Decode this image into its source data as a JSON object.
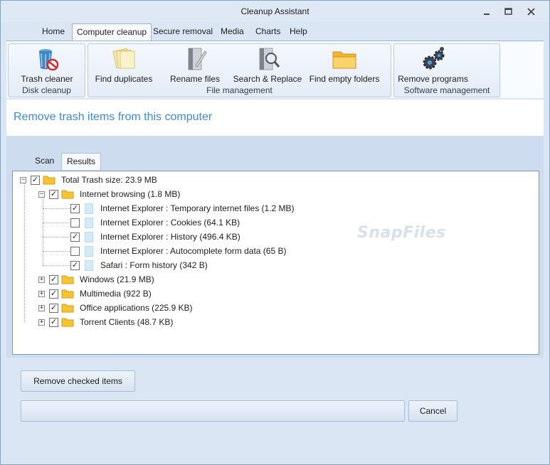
{
  "window": {
    "title": "Cleanup Assistant"
  },
  "menu": [
    {
      "label": "Home"
    },
    {
      "label": "Computer cleanup"
    },
    {
      "label": "Secure removal"
    },
    {
      "label": "Media"
    },
    {
      "label": "Charts"
    },
    {
      "label": "Help"
    }
  ],
  "ribbon": {
    "disk_cleanup": {
      "label": "Disk cleanup",
      "trash_cleaner": "Trash cleaner"
    },
    "file_management": {
      "label": "File management",
      "find_duplicates": "Find duplicates",
      "rename_files": "Rename files",
      "search_replace": "Search & Replace",
      "find_empty_folders": "Find empty folders"
    },
    "software_management": {
      "label": "Software management",
      "remove_programs": "Remove programs"
    }
  },
  "page": {
    "title": "Remove trash items from this computer"
  },
  "tabs": [
    {
      "label": "Scan"
    },
    {
      "label": "Results"
    }
  ],
  "tree": {
    "root": {
      "label": "Total Trash size: 23.9 MB",
      "checked": true
    },
    "internet_browsing": {
      "label": "Internet browsing (1.8 MB)",
      "checked": true,
      "children": [
        {
          "label": "Internet Explorer : Temporary internet files (1.2 MB)",
          "checked": true
        },
        {
          "label": "Internet Explorer : Cookies (64.1 KB)",
          "checked": false
        },
        {
          "label": "Internet Explorer : History (496.4 KB)",
          "checked": true
        },
        {
          "label": "Internet Explorer : Autocomplete form data (65 B)",
          "checked": false
        },
        {
          "label": "Safari : Form history (342 B)",
          "checked": true
        }
      ]
    },
    "others": [
      {
        "label": "Windows (21.9 MB)",
        "checked": true
      },
      {
        "label": "Multimedia (922 B)",
        "checked": true
      },
      {
        "label": "Office applications (225.9 KB)",
        "checked": true
      },
      {
        "label": "Torrent Clients (48.7 KB)",
        "checked": true
      }
    ]
  },
  "watermark": "SnapFiles",
  "buttons": {
    "remove_checked": "Remove checked items",
    "cancel": "Cancel"
  },
  "colors": {
    "accent": "#3c8ad6",
    "folder": "#f5c431"
  }
}
